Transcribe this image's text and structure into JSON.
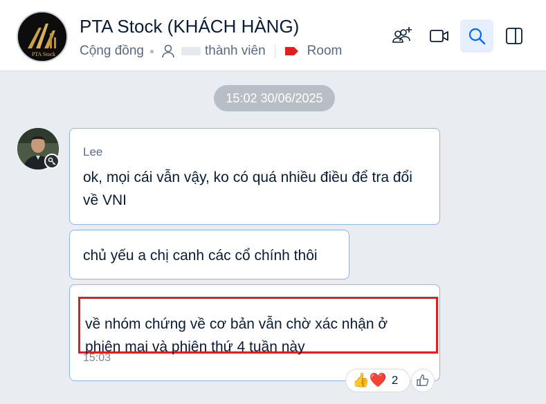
{
  "header": {
    "group_name": "PTA Stock (KHÁCH HÀNG)",
    "category": "Cộng đồng",
    "member_label": "thành viên",
    "room_label": "Room",
    "logo_text": "PTA Stock"
  },
  "colors": {
    "accent": "#0068ff",
    "bubble_border": "#8fb4ea",
    "highlight": "#e01e1e",
    "room_tag": "#e0201e",
    "background": "#e9ecf0"
  },
  "conversation": {
    "date_separator": "15:02 30/06/2025",
    "sender": "Lee",
    "messages": [
      {
        "text": "ok, mọi cái vẫn vậy, ko có quá nhiều điều để tra đổi về VNI"
      },
      {
        "text": "chủ yếu a chị canh các cổ chính thôi"
      },
      {
        "text": "về nhóm chứng về cơ bản vẫn chờ xác nhận ở phiên mai và phiên thứ 4 tuần này",
        "time": "15:03"
      }
    ],
    "reactions": {
      "emojis": [
        "👍",
        "❤️"
      ],
      "count": "2"
    }
  },
  "icons": [
    "add-member-icon",
    "video-call-icon",
    "search-icon",
    "sidebar-toggle-icon",
    "person-icon",
    "tag-icon",
    "key-icon",
    "like-icon"
  ]
}
